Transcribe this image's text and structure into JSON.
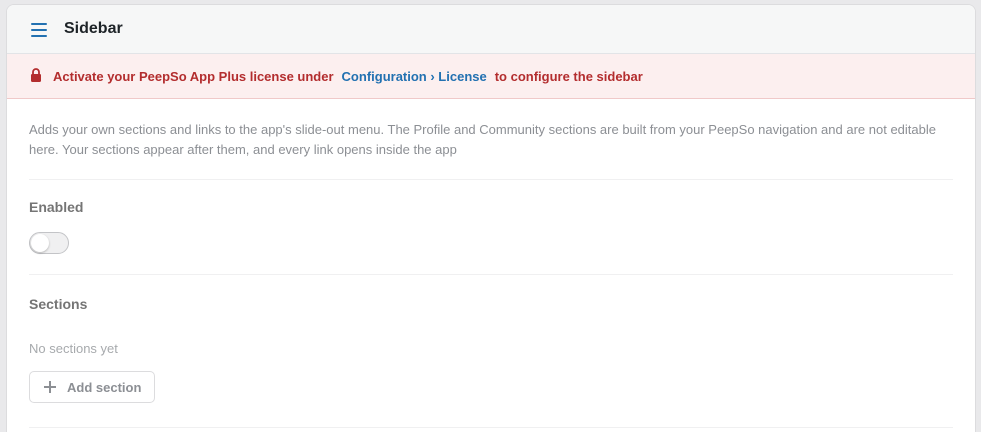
{
  "header": {
    "title": "Sidebar",
    "menu_icon": "hamburger-menu-icon"
  },
  "notice": {
    "icon": "lock-icon",
    "text_before": "Activate your PeepSo App Plus license under",
    "link": "Configuration › License",
    "text_after": "to configure the sidebar",
    "color": "#b32d2e",
    "link_color": "#2271b1"
  },
  "description": "Adds your own sections and links to the app's slide-out menu. The Profile and Community sections are built from your PeepSo navigation and are not editable here. Your sections appear after them, and every link opens inside the app",
  "enabled": {
    "label": "Enabled",
    "value": false
  },
  "sections": {
    "label": "Sections",
    "empty_text": "No sections yet",
    "add_button": "Add section",
    "add_icon": "plus-icon"
  }
}
